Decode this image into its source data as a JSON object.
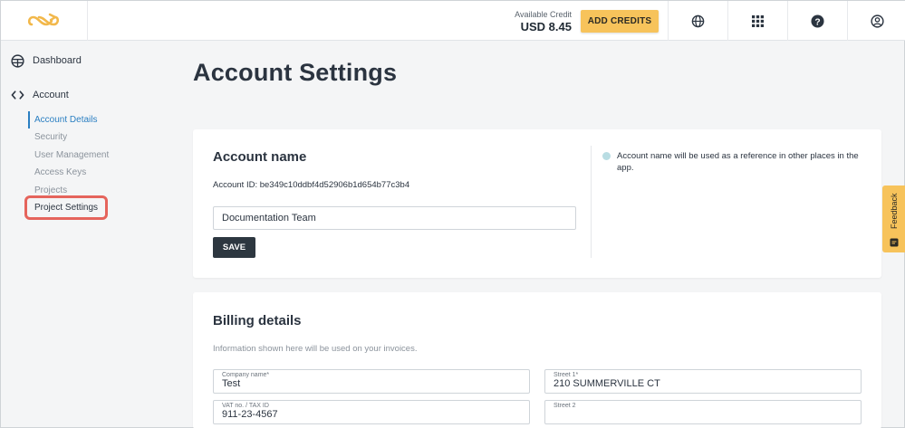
{
  "header": {
    "credit_label": "Available Credit",
    "credit_value": "USD 8.45",
    "add_credits_label": "ADD CREDITS",
    "icons": [
      "globe-icon",
      "apps-grid-icon",
      "help-icon",
      "user-icon"
    ]
  },
  "sidebar": {
    "dashboard_label": "Dashboard",
    "account_label": "Account",
    "items": [
      {
        "label": "Account Details",
        "state": "active"
      },
      {
        "label": "Security",
        "state": "normal"
      },
      {
        "label": "User Management",
        "state": "normal"
      },
      {
        "label": "Access Keys",
        "state": "normal"
      },
      {
        "label": "Projects",
        "state": "normal"
      },
      {
        "label": "Project Settings",
        "state": "highlighted"
      }
    ]
  },
  "main": {
    "page_title": "Account Settings",
    "account_name": {
      "title": "Account name",
      "account_id": "Account ID: be349c10ddbf4d52906b1d654b77c3b4",
      "name_value": "Documentation Team",
      "save_label": "SAVE",
      "info": "Account name will be used as a reference in other places in the app."
    },
    "billing": {
      "title": "Billing details",
      "subtitle": "Information shown here will be used on your invoices.",
      "fields": {
        "company_label": "Company name*",
        "company_value": "Test",
        "street1_label": "Street 1*",
        "street1_value": "210 SUMMERVILLE CT",
        "vat_label": "VAT no. / TAX ID",
        "vat_value": "911-23-4567",
        "street2_label": "Street 2",
        "street2_value": ""
      }
    }
  },
  "feedback_label": "Feedback",
  "colors": {
    "accent": "#f7c35b",
    "active_link": "#2a7fc2",
    "highlight_outline": "#e5645c",
    "dark_button": "#2d3740"
  }
}
